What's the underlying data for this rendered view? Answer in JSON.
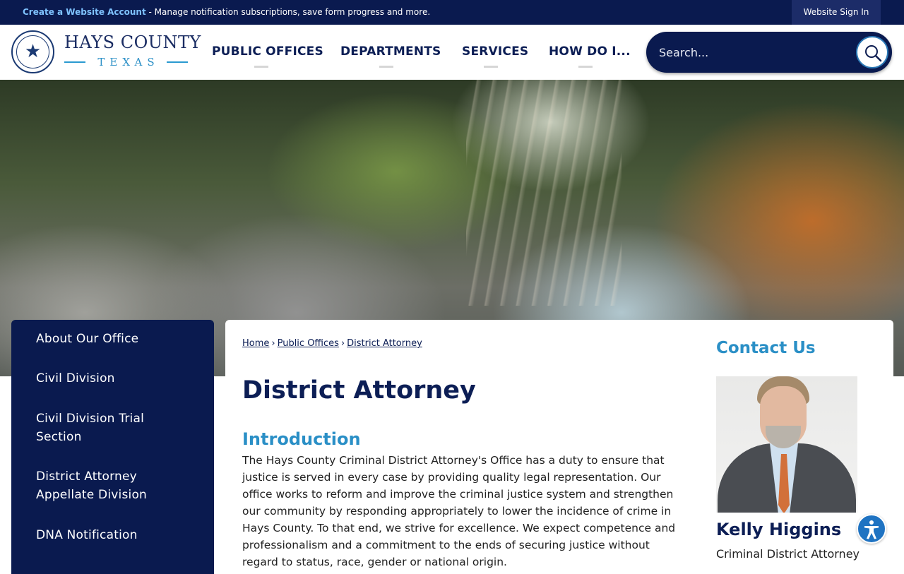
{
  "topbar": {
    "link_text": "Create a Website Account",
    "message": " - Manage notification subscriptions, save form progress and more.",
    "sign_in": "Website Sign In"
  },
  "brand": {
    "name": "HAYS COUNTY",
    "sub": "TEXAS",
    "seal_icon": "county-seal-star"
  },
  "nav": {
    "items": [
      {
        "label": "PUBLIC OFFICES"
      },
      {
        "label": "DEPARTMENTS"
      },
      {
        "label": "SERVICES"
      },
      {
        "label": "HOW DO I..."
      }
    ]
  },
  "search": {
    "placeholder": "Search...",
    "icon": "search-icon"
  },
  "sidebar": {
    "items": [
      {
        "label": "About Our Office"
      },
      {
        "label": "Civil Division"
      },
      {
        "label": "Civil Division Trial Section"
      },
      {
        "label": "District Attorney Appellate Division"
      },
      {
        "label": "DNA Notification"
      }
    ]
  },
  "breadcrumb": {
    "items": [
      "Home",
      "Public Offices",
      "District Attorney"
    ],
    "separator": "›"
  },
  "main": {
    "title": "District Attorney",
    "section_title": "Introduction",
    "intro": "The Hays County Criminal District Attorney's Office has a duty to ensure that justice is served in every case by providing quality legal representation. Our office works to reform and improve the criminal justice system and strengthen our community by responding appropriately to lower the incidence of crime in Hays County. To that end, we strive for excellence. We expect competence and professionalism and a commitment to the ends of securing justice without regard to status, race, gender or national origin."
  },
  "contact": {
    "title": "Contact Us",
    "name": "Kelly Higgins",
    "role": "Criminal District Attorney"
  },
  "accessibility": {
    "icon": "accessibility-icon"
  },
  "colors": {
    "navy": "#0a1a4f",
    "accent_blue": "#2a8fc6",
    "link_blue": "#7fc3ff"
  }
}
